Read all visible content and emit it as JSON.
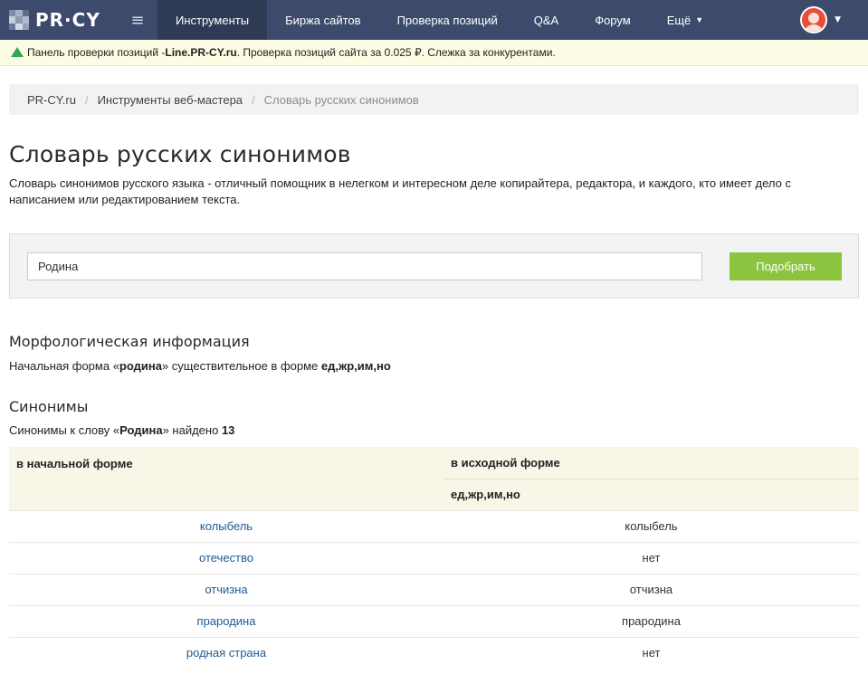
{
  "nav": {
    "logo_text": "PR·CY",
    "items": [
      {
        "label": "Инструменты",
        "active": true
      },
      {
        "label": "Биржа сайтов",
        "active": false
      },
      {
        "label": "Проверка позиций",
        "active": false
      },
      {
        "label": "Q&A",
        "active": false
      },
      {
        "label": "Форум",
        "active": false
      },
      {
        "label": "Ещё",
        "active": false
      }
    ],
    "colors": {
      "bar": "#3c4a6b",
      "active": "#2f3a55"
    }
  },
  "promo": {
    "prefix": "Панель проверки позиций - ",
    "site": "Line.PR-CY.ru",
    "suffix": ". Проверка позиций сайта за 0.025 ₽. Слежка за конкурентами."
  },
  "breadcrumb": {
    "items": [
      "PR-CY.ru",
      "Инструменты веб-мастера",
      "Словарь русских синонимов"
    ]
  },
  "page": {
    "title": "Словарь русских синонимов",
    "description": "Словарь синонимов русского языка - отличный помощник в нелегком и интересном деле копирайтера, редактора, и каждого, кто имеет дело с написанием или редактированием текста."
  },
  "search": {
    "value": "Родина",
    "button_label": "Подобрать",
    "button_color": "#8dc43f"
  },
  "morph": {
    "heading": "Морфологическая информация",
    "prefix": "Начальная форма «",
    "word": "родина",
    "middle": "» существительное в форме ",
    "form": "ед,жр,им,но"
  },
  "synonyms": {
    "heading": "Синонимы",
    "prefix": "Синонимы к слову «",
    "word": "Родина",
    "middle": "» найдено ",
    "count": "13",
    "columns": {
      "initial": "в начальной форме",
      "source": "в исходной форме",
      "source_form": "ед,жр,им,но"
    },
    "rows": [
      {
        "word": "колыбель",
        "form": "колыбель"
      },
      {
        "word": "отечество",
        "form": "нет"
      },
      {
        "word": "отчизна",
        "form": "отчизна"
      },
      {
        "word": "прародина",
        "form": "прародина"
      },
      {
        "word": "родная страна",
        "form": "нет"
      }
    ]
  }
}
